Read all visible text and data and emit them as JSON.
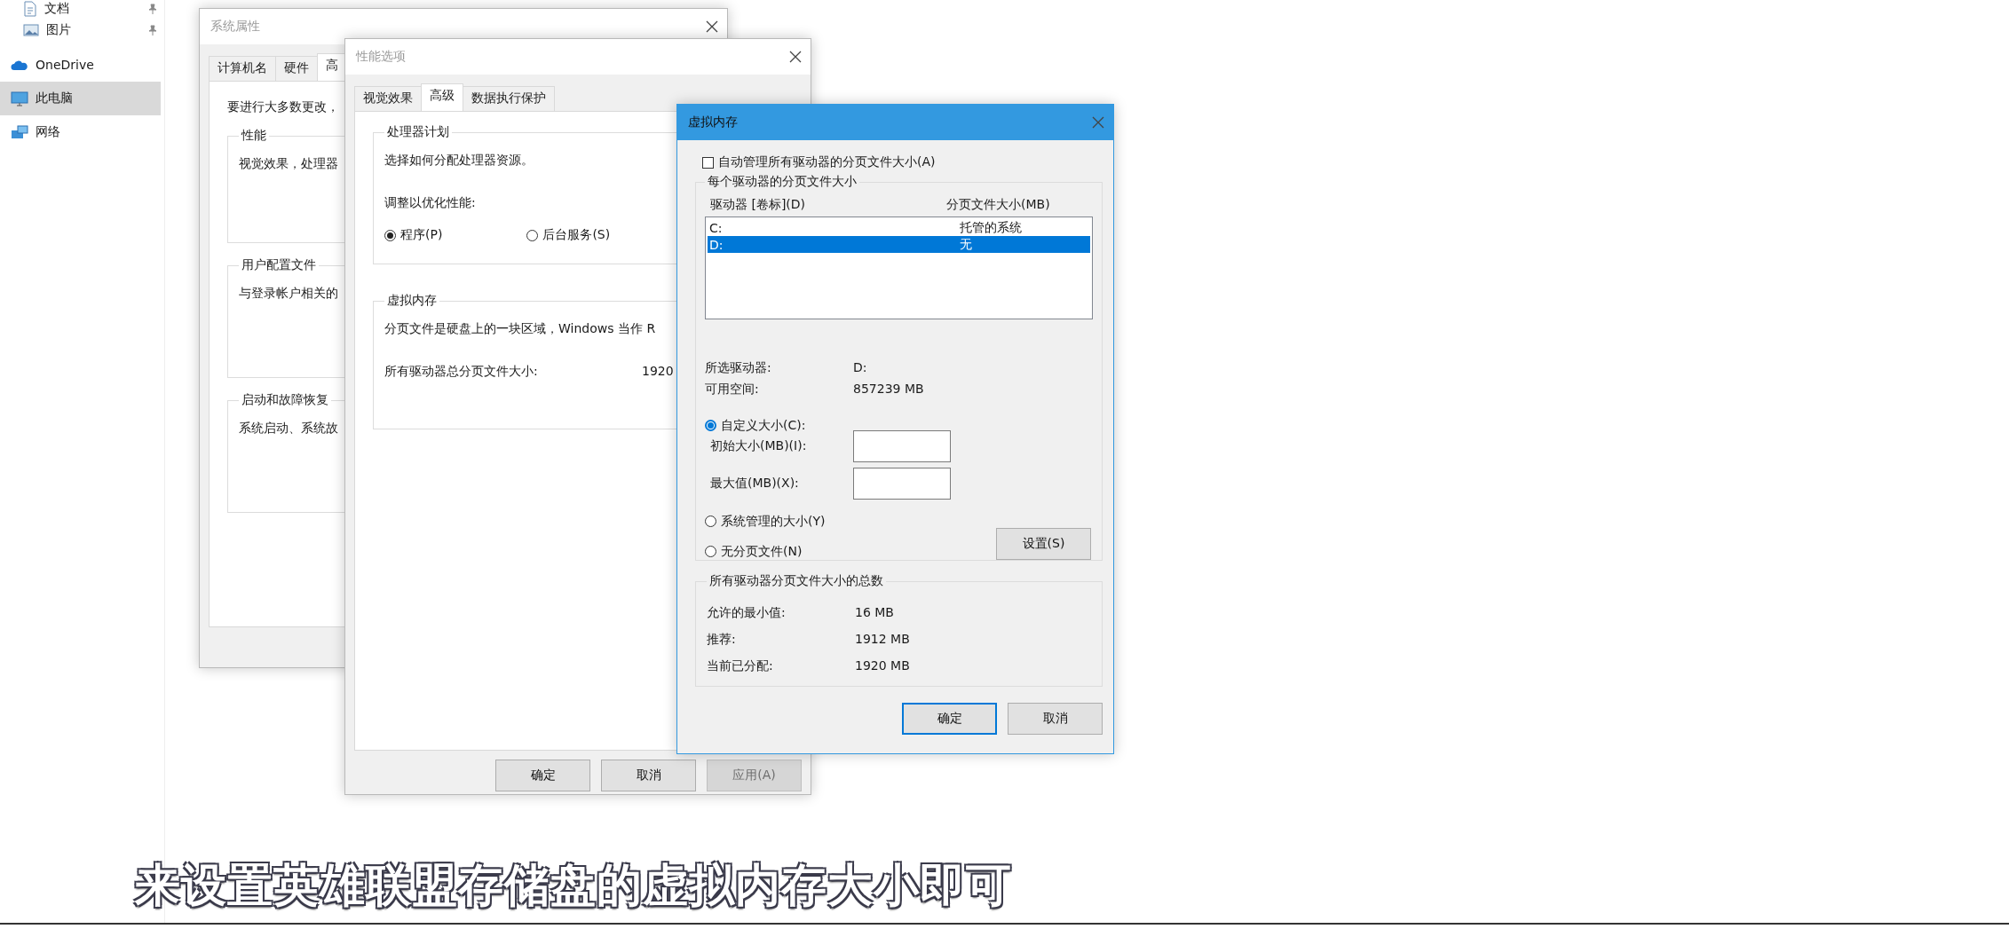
{
  "sidebar": {
    "items": [
      {
        "label": "文档",
        "kind": "documents",
        "pinned": true,
        "selected": false
      },
      {
        "label": "图片",
        "kind": "pictures",
        "pinned": true,
        "selected": false
      },
      {
        "label": "OneDrive",
        "kind": "cloud",
        "pinned": false,
        "selected": false
      },
      {
        "label": "此电脑",
        "kind": "computer",
        "pinned": false,
        "selected": true
      },
      {
        "label": "网络",
        "kind": "network",
        "pinned": false,
        "selected": false
      }
    ]
  },
  "system_properties": {
    "title": "系统属性",
    "active": false,
    "tabs": [
      {
        "label": "计算机名",
        "selected": false
      },
      {
        "label": "硬件",
        "selected": false
      },
      {
        "label": "高",
        "selected": true
      }
    ],
    "intro": "要进行大多数更改，",
    "groups": [
      {
        "title": "性能",
        "text": "视觉效果，处理器"
      },
      {
        "title": "用户配置文件",
        "text": "与登录帐户相关的"
      },
      {
        "title": "启动和故障恢复",
        "text": "系统启动、系统故"
      }
    ]
  },
  "performance_options": {
    "title": "性能选项",
    "active": false,
    "tabs": [
      {
        "label": "视觉效果",
        "selected": false
      },
      {
        "label": "高级",
        "selected": true
      },
      {
        "label": "数据执行保护",
        "selected": false
      }
    ],
    "processor": {
      "title": "处理器计划",
      "text": "选择如何分配处理器资源。",
      "adjust_label": "调整以优化性能:",
      "options": [
        {
          "label": "程序(P)",
          "selected": true
        },
        {
          "label": "后台服务(S)",
          "selected": false
        }
      ]
    },
    "virtual_memory": {
      "title": "虚拟内存",
      "text": "分页文件是硬盘上的一块区域，Windows 当作 R",
      "total_label": "所有驱动器总分页文件大小:",
      "total_value": "1920"
    },
    "buttons": [
      {
        "label": "确定",
        "disabled": false
      },
      {
        "label": "取消",
        "disabled": false
      },
      {
        "label": "应用(A)",
        "disabled": true
      }
    ]
  },
  "virtual_memory": {
    "title": "虚拟内存",
    "active": true,
    "auto_manage": {
      "label": "自动管理所有驱动器的分页文件大小(A)",
      "checked": false
    },
    "drives_group": {
      "title": "每个驱动器的分页文件大小",
      "columns": [
        "驱动器 [卷标](D)",
        "分页文件大小(MB)"
      ],
      "rows": [
        {
          "drive": "C:",
          "size": "托管的系统",
          "selected": false
        },
        {
          "drive": "D:",
          "size": "无",
          "selected": true
        }
      ],
      "selected_drive_label": "所选驱动器:",
      "selected_drive": "D:",
      "free_space_label": "可用空间:",
      "free_space": "857239 MB",
      "size_options": [
        {
          "label": "自定义大小(C):",
          "selected": true
        },
        {
          "label": "系统管理的大小(Y)",
          "selected": false
        },
        {
          "label": "无分页文件(N)",
          "selected": false
        }
      ],
      "fields": [
        {
          "label": "初始大小(MB)(I):"
        },
        {
          "label": "最大值(MB)(X):"
        }
      ],
      "set_button": "设置(S)"
    },
    "totals": {
      "title": "所有驱动器分页文件大小的总数",
      "rows": [
        {
          "label": "允许的最小值:",
          "value": "16 MB"
        },
        {
          "label": "推荐:",
          "value": "1912 MB"
        },
        {
          "label": "当前已分配:",
          "value": "1920 MB"
        }
      ]
    },
    "buttons": [
      {
        "label": "确定",
        "default": true
      },
      {
        "label": "取消",
        "default": false
      }
    ]
  },
  "subtitle": "来设置英雄联盟存储盘的虚拟内存大小即可"
}
